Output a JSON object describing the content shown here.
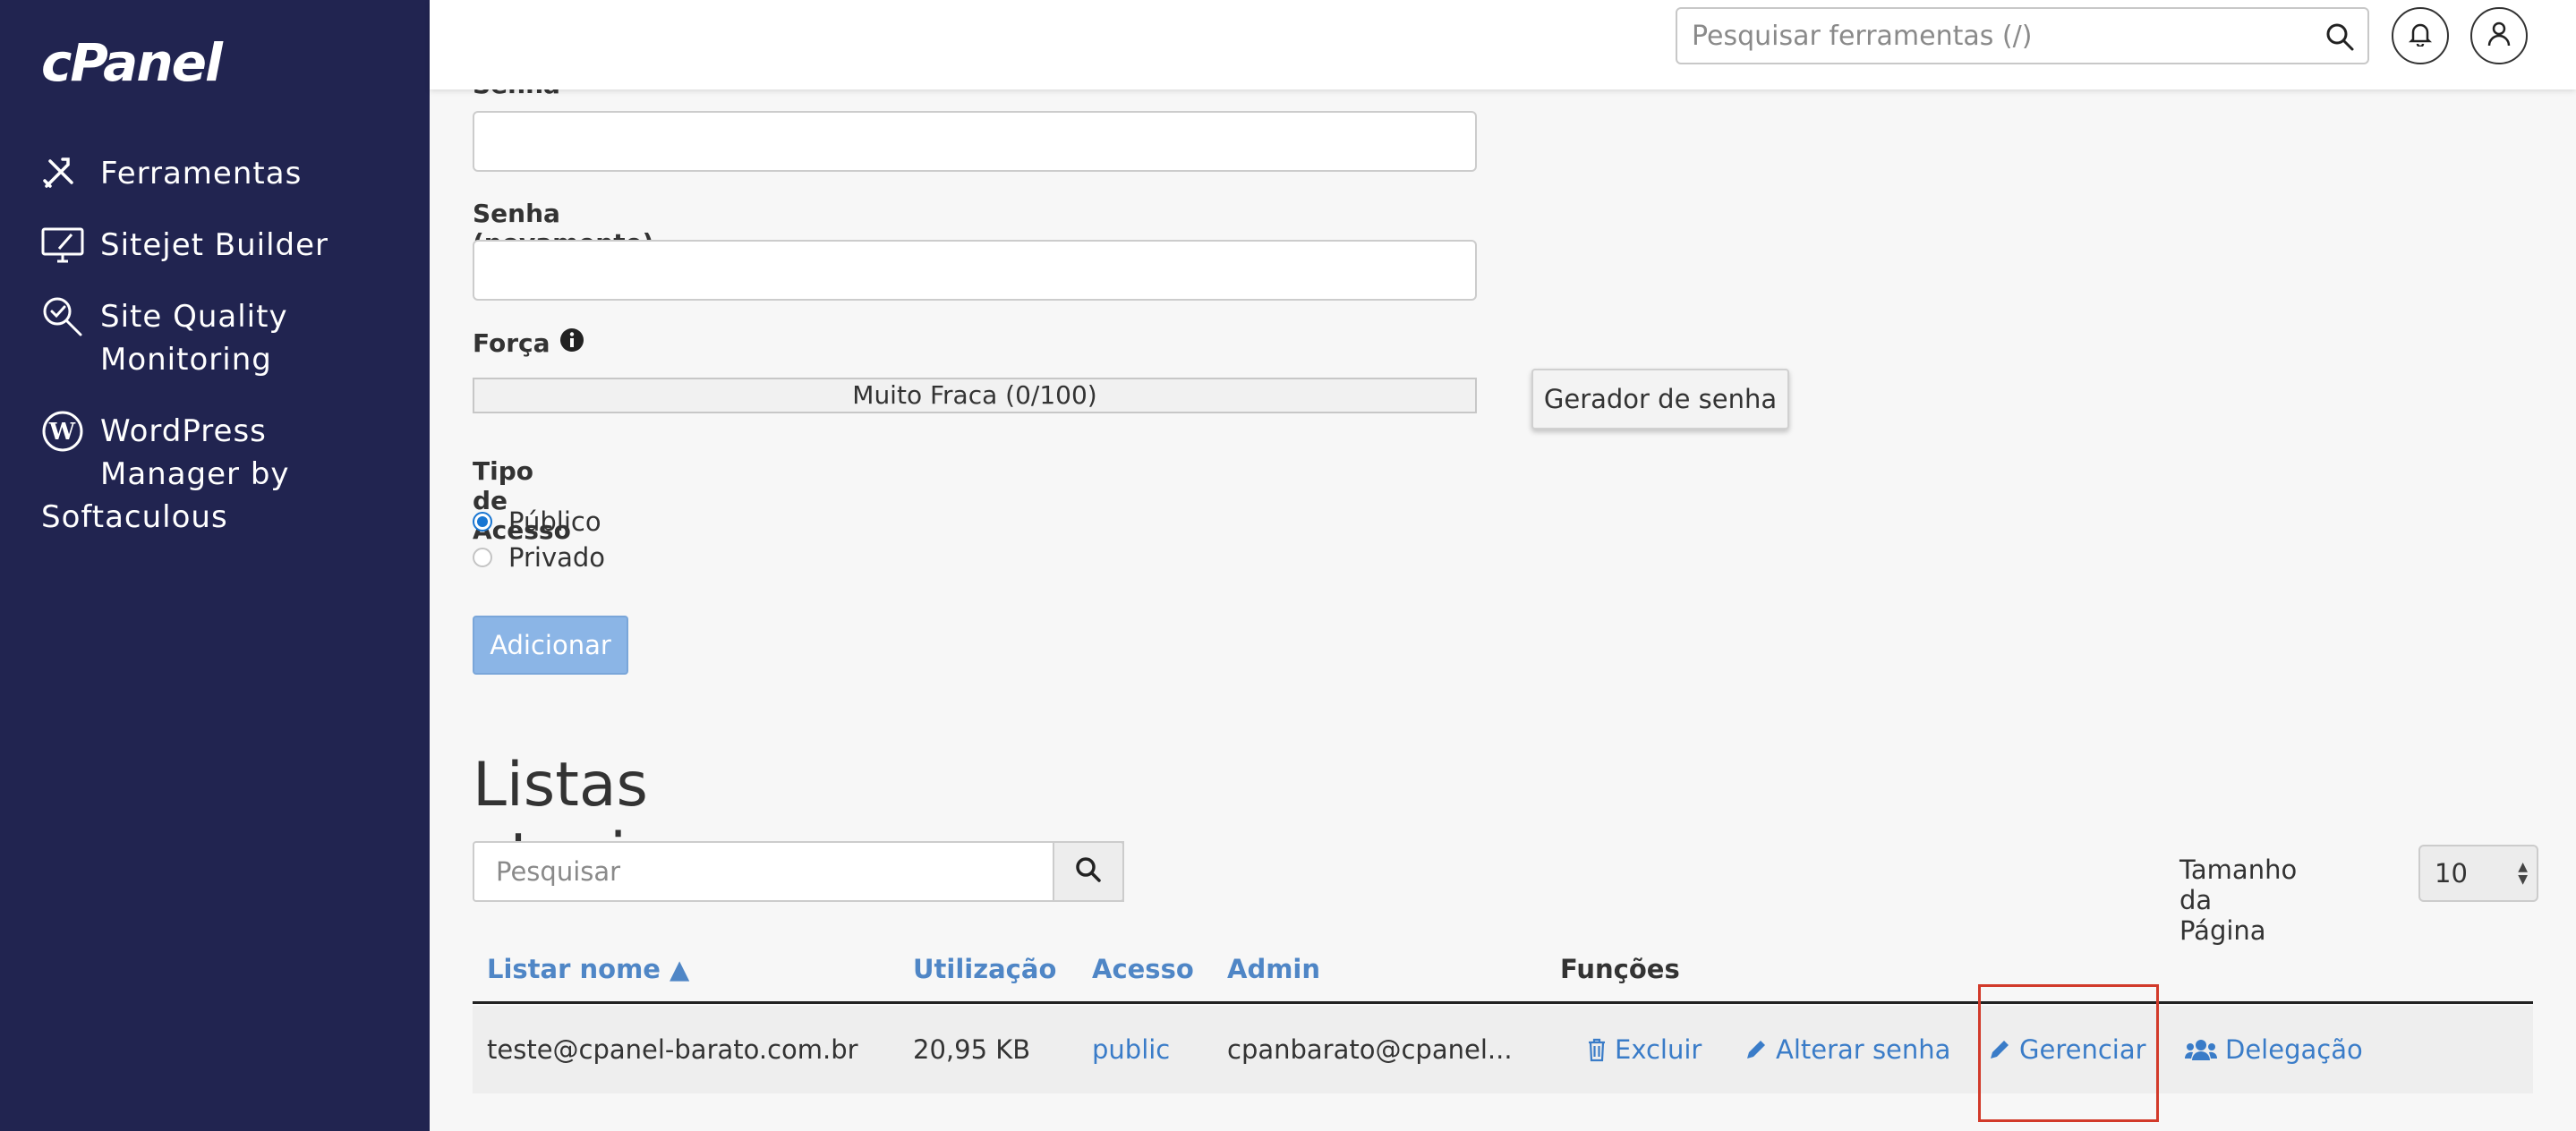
{
  "sidebar": {
    "logo": "cPanel",
    "items": [
      {
        "label": "Ferramentas",
        "icon": "tools-icon"
      },
      {
        "label": "Sitejet Builder",
        "icon": "monitor-design-icon"
      },
      {
        "label": "Site Quality\nMonitoring",
        "icon": "search-check-icon"
      },
      {
        "label": "WordPress\nManager by",
        "label2": "Softaculous",
        "icon": "wordpress-icon"
      }
    ]
  },
  "header": {
    "search_placeholder": "Pesquisar ferramentas (/)"
  },
  "form": {
    "password_label": "Senha",
    "password_again_label": "Senha (novamente)",
    "strength_label": "Força",
    "strength_value": "Muito Fraca (0/100)",
    "generator_button": "Gerador de senha",
    "access_type_label": "Tipo de Acesso",
    "access_options": [
      {
        "label": "Público",
        "checked": true
      },
      {
        "label": "Privado",
        "checked": false
      }
    ],
    "add_button": "Adicionar"
  },
  "lists": {
    "title": "Listas atuais",
    "search_placeholder": "Pesquisar",
    "page_size_label": "Tamanho da Página",
    "page_size_value": "10",
    "columns": [
      "Listar nome ▲",
      "Utilização",
      "Acesso",
      "Admin",
      "Funções"
    ],
    "rows": [
      {
        "name": "teste@cpanel-barato.com.br",
        "usage": "20,95 KB",
        "access": "public",
        "admin": "cpanbarato@cpanel...",
        "actions": {
          "delete": "Excluir",
          "change_password": "Alterar senha",
          "manage": "Gerenciar",
          "delegation": "Delegação"
        }
      }
    ]
  },
  "colors": {
    "sidebar_bg": "#212450",
    "link": "#3a7cc8",
    "header_link": "#4f86c6",
    "highlight": "#d23a2a"
  }
}
